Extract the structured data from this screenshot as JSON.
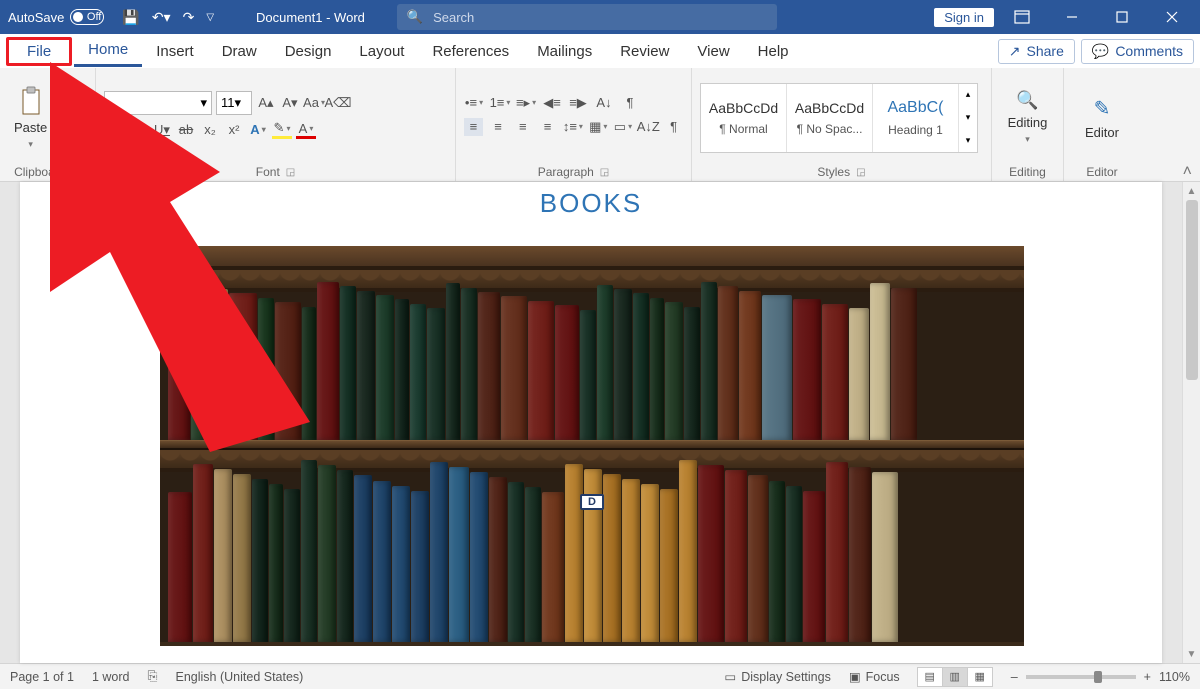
{
  "titlebar": {
    "autosave_label": "AutoSave",
    "autosave_state": "Off",
    "doc_title": "Document1 - Word",
    "search_placeholder": "Search",
    "signin": "Sign in"
  },
  "tabs": {
    "file": "File",
    "items": [
      "Home",
      "Insert",
      "Draw",
      "Design",
      "Layout",
      "References",
      "Mailings",
      "Review",
      "View",
      "Help"
    ],
    "active": "Home",
    "share": "Share",
    "comments": "Comments"
  },
  "ribbon": {
    "clipboard": {
      "paste": "Paste",
      "label": "Clipboard"
    },
    "font": {
      "size": "11",
      "label": "Font"
    },
    "paragraph": {
      "label": "Paragraph"
    },
    "styles": {
      "label": "Styles",
      "items": [
        {
          "sample": "AaBbCcDd",
          "name": "¶ Normal"
        },
        {
          "sample": "AaBbCcDd",
          "name": "¶ No Spac..."
        },
        {
          "sample": "AaBbC(",
          "name": "Heading 1"
        }
      ]
    },
    "editing": {
      "label": "Editing",
      "btn": "Editing"
    },
    "editor": {
      "label": "Editor",
      "btn": "Editor"
    }
  },
  "document": {
    "title": "BOOKS",
    "shelf_tag": "D"
  },
  "status": {
    "page": "Page 1 of 1",
    "words": "1 word",
    "lang": "English (United States)",
    "display": "Display Settings",
    "focus": "Focus",
    "zoom": "110%"
  },
  "bookshelf": {
    "row1_colors": [
      "#6e1f1f",
      "#2e4630",
      "#c9b06a",
      "#7a2a24",
      "#234028",
      "#5e2c20",
      "#223826",
      "#6e1f1f",
      "#1f3a2e",
      "#24332a",
      "#274634",
      "#1d2f26",
      "#26463a",
      "#233b30",
      "#203228",
      "#243a2e",
      "#5a2e22",
      "#6e3a28",
      "#7a2a24",
      "#6e1f1f",
      "#233b30",
      "#274634",
      "#24332a",
      "#1f3a2e",
      "#223826",
      "#2e4630",
      "#203228",
      "#243a2e",
      "#6b3a26",
      "#7a4228",
      "#5d7a8a",
      "#6e1f1f",
      "#7a2a24",
      "#c8b890",
      "#d0c29a",
      "#5a2e22"
    ],
    "row1_widths": [
      22,
      16,
      20,
      28,
      16,
      26,
      14,
      22,
      16,
      18,
      18,
      14,
      16,
      18,
      14,
      16,
      22,
      26,
      26,
      24,
      16,
      16,
      18,
      16,
      14,
      18,
      16,
      16,
      20,
      22,
      30,
      28,
      26,
      20,
      20,
      26
    ],
    "row2_colors": [
      "#6e1f1f",
      "#7a2a24",
      "#b4986a",
      "#9c8252",
      "#1d2f26",
      "#223826",
      "#203228",
      "#243a2e",
      "#2e4630",
      "#203228",
      "#284a6e",
      "#2a4f74",
      "#2c547a",
      "#284a6e",
      "#2a4f74",
      "#35688c",
      "#2c547a",
      "#5a2e22",
      "#233b30",
      "#243a2e",
      "#7a4228",
      "#c08a3a",
      "#c89442",
      "#b07a2e",
      "#c08a3a",
      "#c89442",
      "#b07a2e",
      "#c08a3a",
      "#6e1f1f",
      "#7a2a24",
      "#6b3a26",
      "#223826",
      "#243a2e",
      "#6e1f1f",
      "#7a2a24",
      "#5a2e22",
      "#c8b890"
    ],
    "row2_widths": [
      24,
      20,
      18,
      18,
      16,
      14,
      16,
      16,
      18,
      16,
      18,
      18,
      18,
      18,
      18,
      20,
      18,
      18,
      16,
      16,
      22,
      18,
      18,
      18,
      18,
      18,
      18,
      18,
      26,
      22,
      20,
      16,
      16,
      22,
      22,
      22,
      26
    ]
  }
}
